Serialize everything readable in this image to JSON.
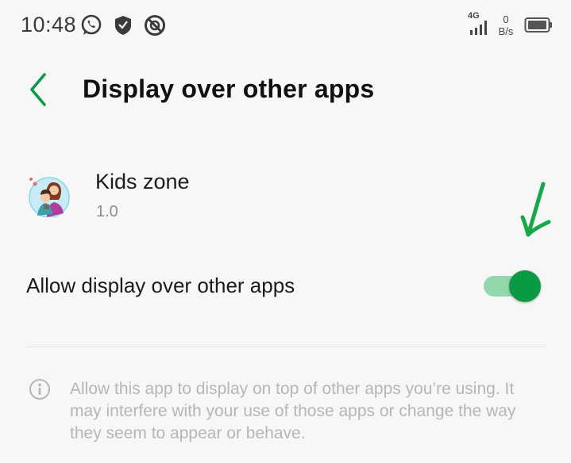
{
  "status_bar": {
    "time": "10:48",
    "network_type": "4G",
    "speed_value": "0",
    "speed_unit": "B/s",
    "icons": [
      "whatsapp-icon",
      "shield-icon",
      "no-disturb-icon",
      "signal-icon",
      "battery-icon"
    ]
  },
  "toolbar": {
    "back_icon": "chevron-left-icon",
    "title": "Display over other apps"
  },
  "app": {
    "name": "Kids zone",
    "version": "1.0"
  },
  "setting": {
    "label": "Allow display over other apps",
    "enabled": true
  },
  "info": {
    "icon": "info-icon",
    "text": "Allow this app to display on top of other apps you’re using. It may interfere with your use of those apps or change the way they seem to appear or behave."
  },
  "colors": {
    "accent": "#0a9a43",
    "track_on": "#93d7ac",
    "annotation": "#1aa64a"
  }
}
